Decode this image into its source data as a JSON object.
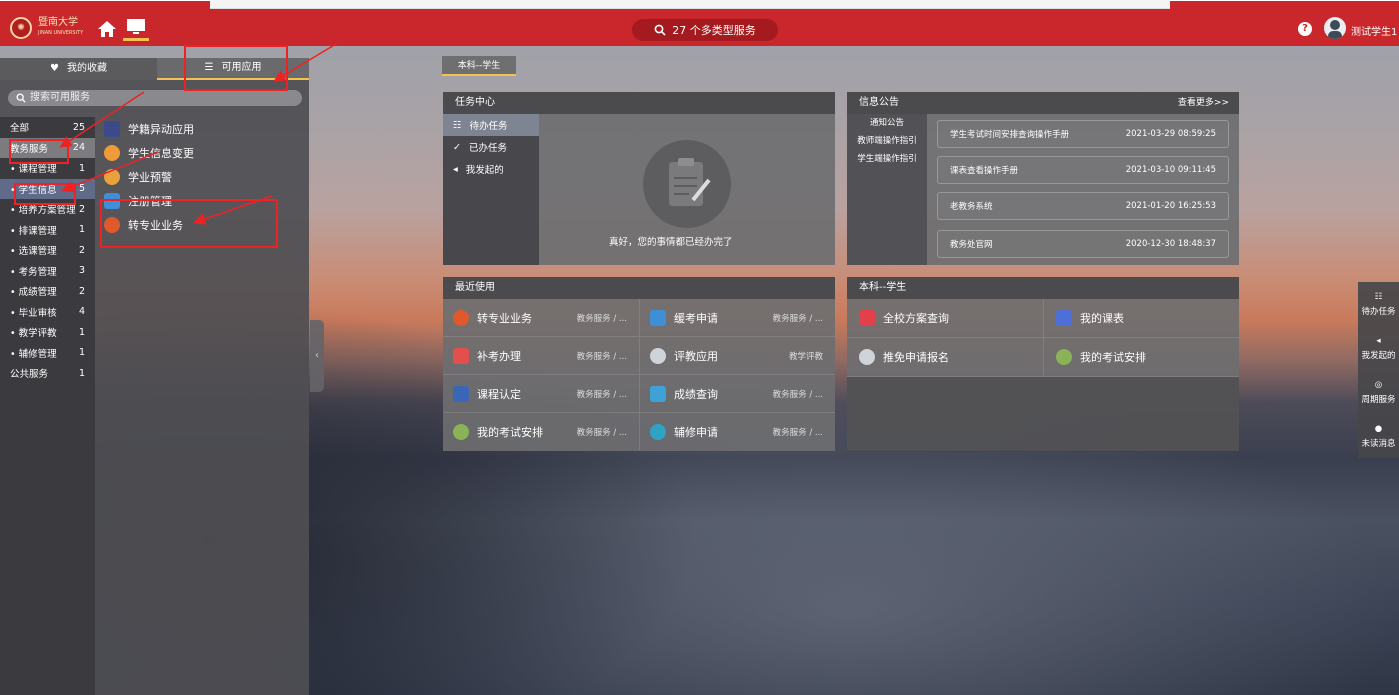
{
  "topbar": {
    "logo_text": "暨南大学",
    "logo_sub": "JINAN UNIVERSITY",
    "search_label": "27 个多类型服务",
    "user_name": "测试学生1"
  },
  "left_tabs": {
    "favorites": "我的收藏",
    "apps": "可用应用"
  },
  "left_search_placeholder": "搜索可用服务",
  "categories": [
    {
      "label": "全部",
      "count": "25"
    },
    {
      "label": "教务服务",
      "count": "24"
    },
    {
      "label": "• 课程管理",
      "count": "1"
    },
    {
      "label": "• 学生信息",
      "count": "5"
    },
    {
      "label": "• 培养方案管理",
      "count": "2"
    },
    {
      "label": "• 排课管理",
      "count": "1"
    },
    {
      "label": "• 选课管理",
      "count": "2"
    },
    {
      "label": "• 考务管理",
      "count": "3"
    },
    {
      "label": "• 成绩管理",
      "count": "2"
    },
    {
      "label": "• 毕业审核",
      "count": "4"
    },
    {
      "label": "• 教学评教",
      "count": "1"
    },
    {
      "label": "• 辅修管理",
      "count": "1"
    },
    {
      "label": "公共服务",
      "count": "1"
    }
  ],
  "apps": [
    {
      "label": "学籍异动应用",
      "color": "#3a4a8c"
    },
    {
      "label": "学生信息变更",
      "color": "#f19a3a"
    },
    {
      "label": "学业预警",
      "color": "#e8a13b"
    },
    {
      "label": "注册管理",
      "color": "#3f8ed8"
    },
    {
      "label": "转专业业务",
      "color": "#e0592a"
    }
  ],
  "role_tab": "本科--学生",
  "task_center": {
    "title": "任务中心",
    "nav": [
      "待办任务",
      "已办任务",
      "我发起的"
    ],
    "empty_text": "真好，您的事情都已经办完了"
  },
  "notices": {
    "title": "信息公告",
    "more": "查看更多>>",
    "nav": [
      "通知公告",
      "教师端操作指引",
      "学生端操作指引"
    ],
    "items": [
      {
        "text": "学生考试时间安排查询操作手册",
        "date": "2021-03-29 08:59:25"
      },
      {
        "text": "课表查看操作手册",
        "date": "2021-03-10 09:11:45"
      },
      {
        "text": "老教务系统",
        "date": "2021-01-20 16:25:53"
      },
      {
        "text": "教务处官网",
        "date": "2020-12-30 18:48:37"
      }
    ]
  },
  "recent": {
    "title": "最近使用",
    "items": [
      {
        "label": "转专业业务",
        "cat": "教务服务 / ...",
        "color": "#e0592a"
      },
      {
        "label": "缓考申请",
        "cat": "教务服务 / ...",
        "color": "#3f8ed8"
      },
      {
        "label": "补考办理",
        "cat": "教务服务 / ...",
        "color": "#e2504d"
      },
      {
        "label": "评教应用",
        "cat": "教学评教",
        "color": "#cfd4db"
      },
      {
        "label": "课程认定",
        "cat": "教务服务 / ...",
        "color": "#3a66b8"
      },
      {
        "label": "成绩查询",
        "cat": "教务服务 / ...",
        "color": "#3fa1d8"
      },
      {
        "label": "我的考试安排",
        "cat": "教务服务 / ...",
        "color": "#8ab356"
      },
      {
        "label": "辅修申请",
        "cat": "教务服务 / ...",
        "color": "#2fa3c6"
      }
    ]
  },
  "student": {
    "title": "本科--学生",
    "items": [
      {
        "label": "全校方案查询",
        "color": "#e2404a"
      },
      {
        "label": "我的课表",
        "color": "#4d6fd8"
      },
      {
        "label": "推免申请报名",
        "color": "#cfd4db"
      },
      {
        "label": "我的考试安排",
        "color": "#8ab356"
      }
    ]
  },
  "dock": [
    "待办任务",
    "我发起的",
    "周期服务",
    "未读消息"
  ],
  "colors": {
    "brand": "#c9272c",
    "accent": "#f4c34f",
    "highlight": "#e22222"
  }
}
